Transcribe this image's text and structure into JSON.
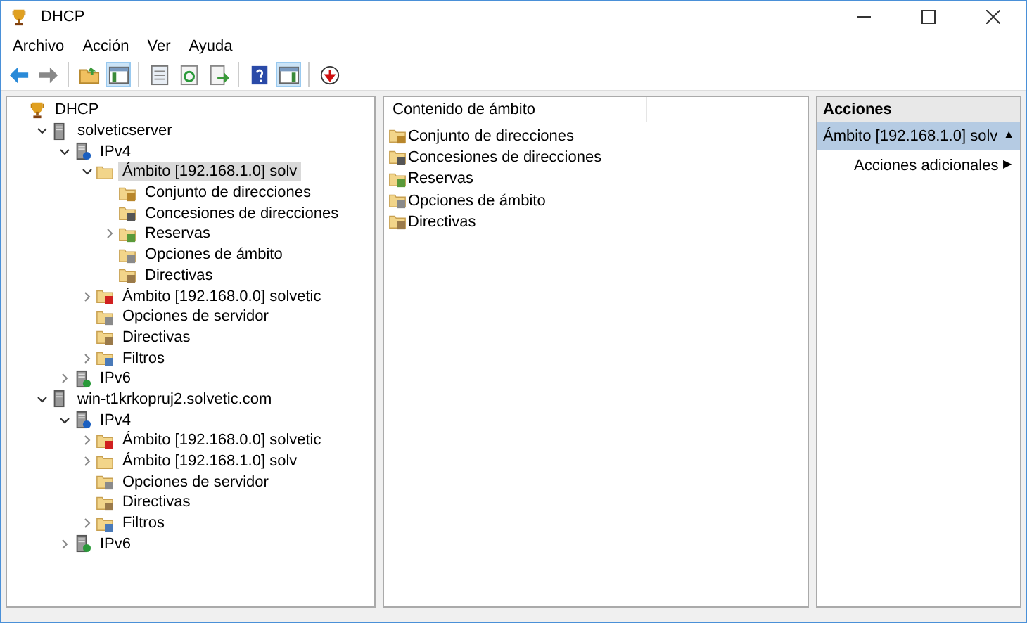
{
  "window": {
    "title": "DHCP"
  },
  "menu": [
    "Archivo",
    "Acción",
    "Ver",
    "Ayuda"
  ],
  "toolbar": [
    {
      "kind": "back",
      "pressed": false
    },
    {
      "kind": "forward",
      "pressed": false
    },
    {
      "kind": "sep"
    },
    {
      "kind": "up",
      "pressed": false
    },
    {
      "kind": "tree",
      "pressed": true
    },
    {
      "kind": "sep"
    },
    {
      "kind": "props",
      "pressed": false
    },
    {
      "kind": "refresh",
      "pressed": false
    },
    {
      "kind": "export",
      "pressed": false
    },
    {
      "kind": "sep"
    },
    {
      "kind": "help",
      "pressed": false
    },
    {
      "kind": "actionpane",
      "pressed": true
    },
    {
      "kind": "sep"
    },
    {
      "kind": "stop",
      "pressed": false
    }
  ],
  "tree": [
    {
      "label": "DHCP",
      "kind": "dhcp",
      "selected": false,
      "children": [
        {
          "label": "solveticserver",
          "kind": "server",
          "expanded": true,
          "selected": false,
          "children": [
            {
              "label": "IPv4",
              "kind": "ipv4",
              "expanded": true,
              "selected": false,
              "children": [
                {
                  "label": "Ámbito [192.168.1.0] solv",
                  "kind": "scope",
                  "expanded": true,
                  "selected": true,
                  "children": [
                    {
                      "label": "Conjunto de direcciones",
                      "kind": "pool",
                      "selected": false
                    },
                    {
                      "label": "Concesiones de direcciones",
                      "kind": "leases",
                      "selected": false
                    },
                    {
                      "label": "Reservas",
                      "kind": "reservations",
                      "expanded": false,
                      "selected": false
                    },
                    {
                      "label": "Opciones de ámbito",
                      "kind": "options",
                      "selected": false
                    },
                    {
                      "label": "Directivas",
                      "kind": "policies",
                      "selected": false
                    }
                  ]
                },
                {
                  "label": "Ámbito [192.168.0.0] solvetic",
                  "kind": "scope-inactive",
                  "expanded": false,
                  "selected": false
                },
                {
                  "label": "Opciones de servidor",
                  "kind": "options",
                  "selected": false
                },
                {
                  "label": "Directivas",
                  "kind": "policies",
                  "selected": false
                },
                {
                  "label": "Filtros",
                  "kind": "filters",
                  "expanded": false,
                  "selected": false
                }
              ]
            },
            {
              "label": "IPv6",
              "kind": "ipv6",
              "expanded": false,
              "selected": false
            }
          ]
        },
        {
          "label": "win-t1krkopruj2.solvetic.com",
          "kind": "server",
          "expanded": true,
          "selected": false,
          "children": [
            {
              "label": "IPv4",
              "kind": "ipv4",
              "expanded": true,
              "selected": false,
              "children": [
                {
                  "label": "Ámbito [192.168.0.0] solvetic",
                  "kind": "scope-inactive",
                  "expanded": false,
                  "selected": false
                },
                {
                  "label": "Ámbito [192.168.1.0] solv",
                  "kind": "scope",
                  "expanded": false,
                  "selected": false
                },
                {
                  "label": "Opciones de servidor",
                  "kind": "options",
                  "selected": false
                },
                {
                  "label": "Directivas",
                  "kind": "policies",
                  "selected": false
                },
                {
                  "label": "Filtros",
                  "kind": "filters",
                  "expanded": false,
                  "selected": false
                }
              ]
            },
            {
              "label": "IPv6",
              "kind": "ipv6",
              "expanded": false,
              "selected": false
            }
          ]
        }
      ]
    }
  ],
  "content": {
    "column": "Contenido de ámbito",
    "items": [
      {
        "label": "Conjunto de direcciones",
        "kind": "pool"
      },
      {
        "label": "Concesiones de direcciones",
        "kind": "leases"
      },
      {
        "label": "Reservas",
        "kind": "reservations"
      },
      {
        "label": "Opciones de ámbito",
        "kind": "options"
      },
      {
        "label": "Directivas",
        "kind": "policies"
      }
    ]
  },
  "actions": {
    "title": "Acciones",
    "groups": [
      {
        "label": "Ámbito [192.168.1.0] solv",
        "glyph": "▲",
        "selected": true,
        "items": [
          {
            "label": "Acciones adicionales",
            "glyph": "▶"
          }
        ]
      }
    ]
  }
}
